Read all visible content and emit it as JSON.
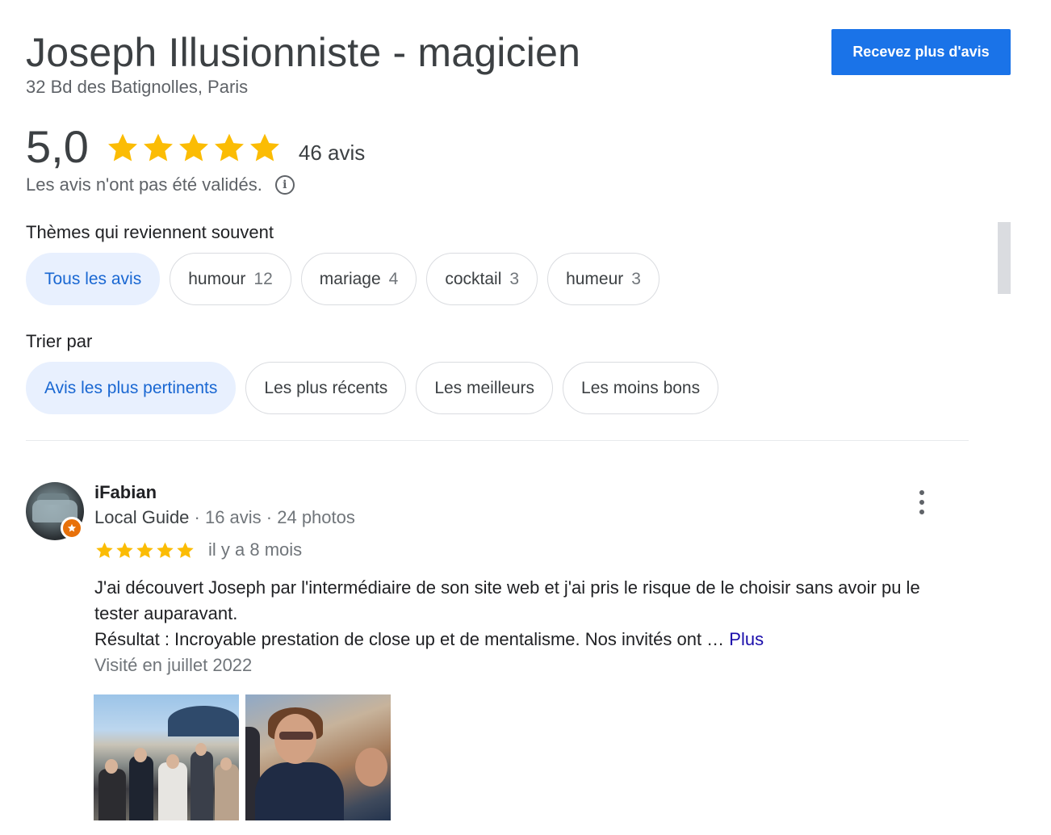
{
  "business": {
    "name": "Joseph Illusionniste - magicien",
    "address": "32 Bd des Batignolles, Paris"
  },
  "cta": {
    "label": "Recevez plus d'avis"
  },
  "rating": {
    "value": "5,0",
    "stars": 5,
    "count_label": "46 avis",
    "disclaimer": "Les avis n'ont pas été validés.",
    "star_color": "#fbbc04"
  },
  "themes": {
    "label": "Thèmes qui reviennent souvent",
    "chips": [
      {
        "label": "Tous les avis",
        "count": ""
      },
      {
        "label": "humour",
        "count": "12"
      },
      {
        "label": "mariage",
        "count": "4"
      },
      {
        "label": "cocktail",
        "count": "3"
      },
      {
        "label": "humeur",
        "count": "3"
      }
    ]
  },
  "sort": {
    "label": "Trier par",
    "options": [
      "Avis les plus pertinents",
      "Les plus récents",
      "Les meilleurs",
      "Les moins bons"
    ]
  },
  "review": {
    "author": "iFabian",
    "guide_label": "Local Guide",
    "meta": " · 16 avis · 24 photos",
    "stars": 5,
    "date": "il y a 8 mois",
    "text_line1": "J'ai découvert Joseph par l'intermédiaire de son site web et j'ai pris le risque de le choisir sans avoir pu le tester auparavant.",
    "text_line2": "Résultat : Incroyable prestation de close up et de mentalisme. Nos invités ont … ",
    "more_label": "Plus",
    "visited": "Visité en juillet 2022",
    "photos": [
      "group-on-rooftop-photo",
      "woman-with-glasses-photo"
    ]
  },
  "colors": {
    "accent": "#1a73e8",
    "chip_active_bg": "#e8f0fe",
    "chip_active_text": "#1967d2",
    "link": "#1a0dab",
    "local_guide_badge": "#e8710a"
  }
}
